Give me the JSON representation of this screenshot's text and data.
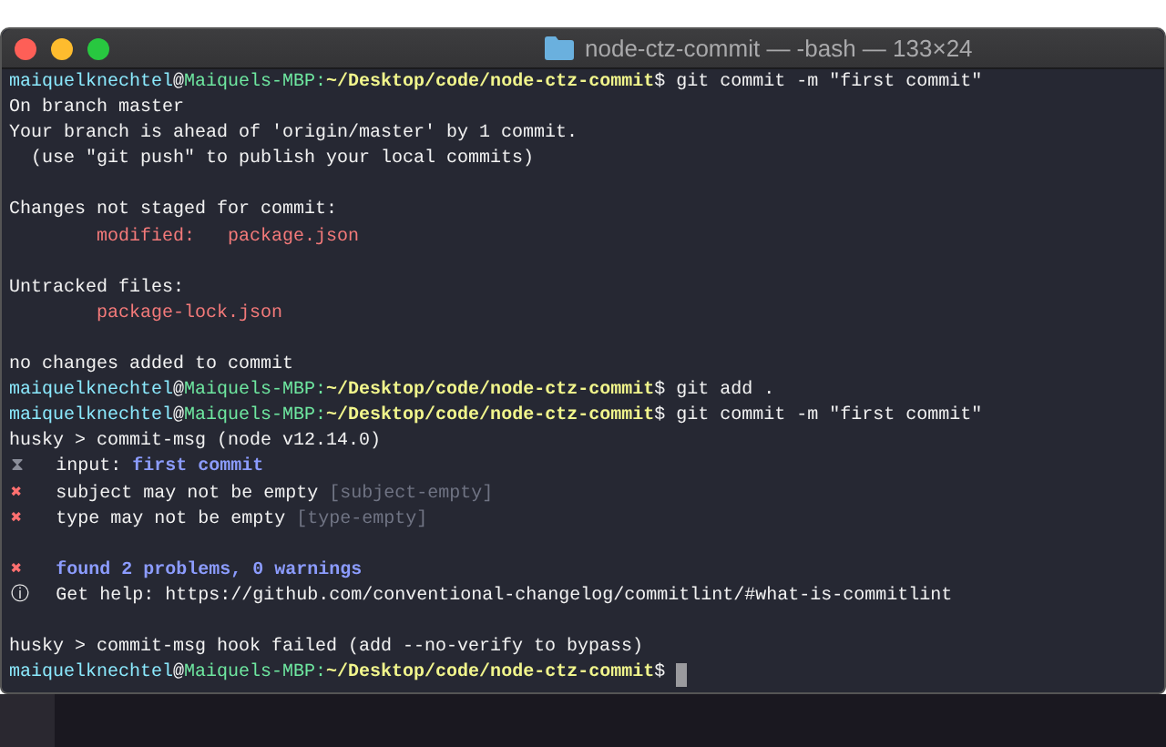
{
  "window": {
    "title": "node-ctz-commit — -bash — 133×24"
  },
  "lines": [
    {
      "kind": "text",
      "segments": [
        {
          "kind": "user",
          "text": "maiquelknechtel"
        },
        {
          "kind": "plain",
          "text": "@"
        },
        {
          "kind": "host",
          "text": "Maiquels-MBP:"
        },
        {
          "kind": "path",
          "text": "~/Desktop/code/node-ctz-commit"
        },
        {
          "kind": "plain",
          "text": "$ git commit -m \"first commit\""
        }
      ]
    },
    {
      "kind": "text",
      "segments": [
        {
          "kind": "plain",
          "text": "On branch master"
        }
      ]
    },
    {
      "kind": "text",
      "segments": [
        {
          "kind": "plain",
          "text": "Your branch is ahead of 'origin/master' by 1 commit."
        }
      ]
    },
    {
      "kind": "text",
      "segments": [
        {
          "kind": "plain",
          "text": "  (use \"git push\" to publish your local commits)"
        }
      ]
    },
    {
      "kind": "blank"
    },
    {
      "kind": "text",
      "segments": [
        {
          "kind": "plain",
          "text": "Changes not staged for commit:"
        }
      ]
    },
    {
      "kind": "text",
      "segments": [
        {
          "kind": "red",
          "text": "        modified:   package.json"
        }
      ]
    },
    {
      "kind": "blank"
    },
    {
      "kind": "text",
      "segments": [
        {
          "kind": "plain",
          "text": "Untracked files:"
        }
      ]
    },
    {
      "kind": "text",
      "segments": [
        {
          "kind": "red",
          "text": "        package-lock.json"
        }
      ]
    },
    {
      "kind": "blank"
    },
    {
      "kind": "text",
      "segments": [
        {
          "kind": "plain",
          "text": "no changes added to commit"
        }
      ]
    },
    {
      "kind": "text",
      "segments": [
        {
          "kind": "user",
          "text": "maiquelknechtel"
        },
        {
          "kind": "plain",
          "text": "@"
        },
        {
          "kind": "host",
          "text": "Maiquels-MBP:"
        },
        {
          "kind": "path",
          "text": "~/Desktop/code/node-ctz-commit"
        },
        {
          "kind": "plain",
          "text": "$ git add ."
        }
      ]
    },
    {
      "kind": "text",
      "segments": [
        {
          "kind": "user",
          "text": "maiquelknechtel"
        },
        {
          "kind": "plain",
          "text": "@"
        },
        {
          "kind": "host",
          "text": "Maiquels-MBP:"
        },
        {
          "kind": "path",
          "text": "~/Desktop/code/node-ctz-commit"
        },
        {
          "kind": "plain",
          "text": "$ git commit -m \"first commit\""
        }
      ]
    },
    {
      "kind": "text",
      "segments": [
        {
          "kind": "plain",
          "text": "husky > commit-msg (node v12.14.0)"
        }
      ]
    },
    {
      "kind": "text",
      "mark": {
        "kind": "hourglass",
        "text": "⧗"
      },
      "segments": [
        {
          "kind": "plain",
          "text": "input: "
        },
        {
          "kind": "blue",
          "text": "first commit"
        }
      ]
    },
    {
      "kind": "text",
      "mark": {
        "kind": "cross",
        "text": "✖"
      },
      "segments": [
        {
          "kind": "plain",
          "text": "subject may not be empty "
        },
        {
          "kind": "dim",
          "text": "[subject-empty]"
        }
      ]
    },
    {
      "kind": "text",
      "mark": {
        "kind": "cross",
        "text": "✖"
      },
      "segments": [
        {
          "kind": "plain",
          "text": "type may not be empty "
        },
        {
          "kind": "dim",
          "text": "[type-empty]"
        }
      ]
    },
    {
      "kind": "blank"
    },
    {
      "kind": "text",
      "mark": {
        "kind": "cross",
        "text": "✖"
      },
      "segments": [
        {
          "kind": "blue",
          "text": "found 2 problems, 0 warnings"
        }
      ]
    },
    {
      "kind": "text",
      "mark": {
        "kind": "info",
        "text": "ⓘ"
      },
      "segments": [
        {
          "kind": "plain",
          "text": "Get help: https://github.com/conventional-changelog/commitlint/#what-is-commitlint"
        }
      ]
    },
    {
      "kind": "blank"
    },
    {
      "kind": "text",
      "segments": [
        {
          "kind": "plain",
          "text": "husky > commit-msg hook failed (add --no-verify to bypass)"
        }
      ]
    },
    {
      "kind": "text",
      "cursor": true,
      "segments": [
        {
          "kind": "user",
          "text": "maiquelknechtel"
        },
        {
          "kind": "plain",
          "text": "@"
        },
        {
          "kind": "host",
          "text": "Maiquels-MBP:"
        },
        {
          "kind": "path",
          "text": "~/Desktop/code/node-ctz-commit"
        },
        {
          "kind": "plain",
          "text": "$ "
        }
      ]
    }
  ]
}
